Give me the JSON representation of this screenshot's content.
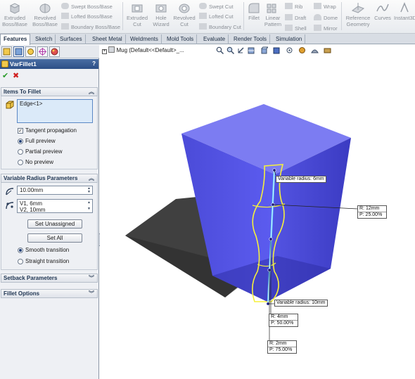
{
  "ribbon": {
    "extruded_boss": "Extruded\nBoss/Base",
    "revolved_boss": "Revolved\nBoss/Base",
    "swept_boss": "Swept Boss/Base",
    "lofted_boss": "Lofted Boss/Base",
    "boundary_boss": "Boundary Boss/Base",
    "extruded_cut": "Extruded\nCut",
    "hole_wizard": "Hole\nWizard",
    "revolved_cut": "Revolved\nCut",
    "swept_cut": "Swept Cut",
    "lofted_cut": "Lofted Cut",
    "boundary_cut": "Boundary Cut",
    "fillet": "Fillet",
    "linear_pattern": "Linear\nPattern",
    "rib": "Rib",
    "draft": "Draft",
    "shell": "Shell",
    "wrap": "Wrap",
    "dome": "Dome",
    "mirror": "Mirror",
    "reference_geometry": "Reference\nGeometry",
    "curves": "Curves",
    "instant3d": "Instant3D"
  },
  "tabs": [
    "Features",
    "Sketch",
    "Surfaces",
    "Sheet Metal",
    "Weldments",
    "Mold Tools",
    "Evaluate",
    "Render Tools",
    "Simulation"
  ],
  "active_tab": "Features",
  "property_manager": {
    "title": "VarFillet1",
    "help": "?",
    "ok": "✔",
    "cancel": "✖",
    "items_to_fillet": {
      "header": "Items To Fillet",
      "selection": "Edge<1>",
      "tangent_propagation": "Tangent propagation",
      "full_preview": "Full preview",
      "partial_preview": "Partial preview",
      "no_preview": "No preview"
    },
    "variable_radius": {
      "header": "Variable Radius Parameters",
      "radius_value": "10.00mm",
      "v1": "V1, 6mm",
      "v2": "V2, 10mm",
      "set_unassigned": "Set Unassigned",
      "set_all": "Set All",
      "smooth_transition": "Smooth transition",
      "straight_transition": "Straight transition"
    },
    "setback_header": "Setback Parameters",
    "fillet_options_header": "Fillet Options"
  },
  "graphics": {
    "tree_label": "Mug  (Default<<Default>_...",
    "callout_top": "Variable radius:  6mm",
    "callout_bottom": "Variable radius:  10mm",
    "point1": {
      "r": "R:  12mm",
      "p": "P:  25.00%"
    },
    "point2": {
      "r": "R:  4mm",
      "p": "P:  50.00%"
    },
    "point3": {
      "r": "R:  2mm",
      "p": "P:  75.00%"
    }
  },
  "colors": {
    "model_front": "#5050e0",
    "model_right": "#3a3ac8",
    "model_top": "#7a7af0",
    "edge_highlight": "#f5f03c",
    "shadow": "#404040",
    "title_bar": "#2c4f86"
  }
}
